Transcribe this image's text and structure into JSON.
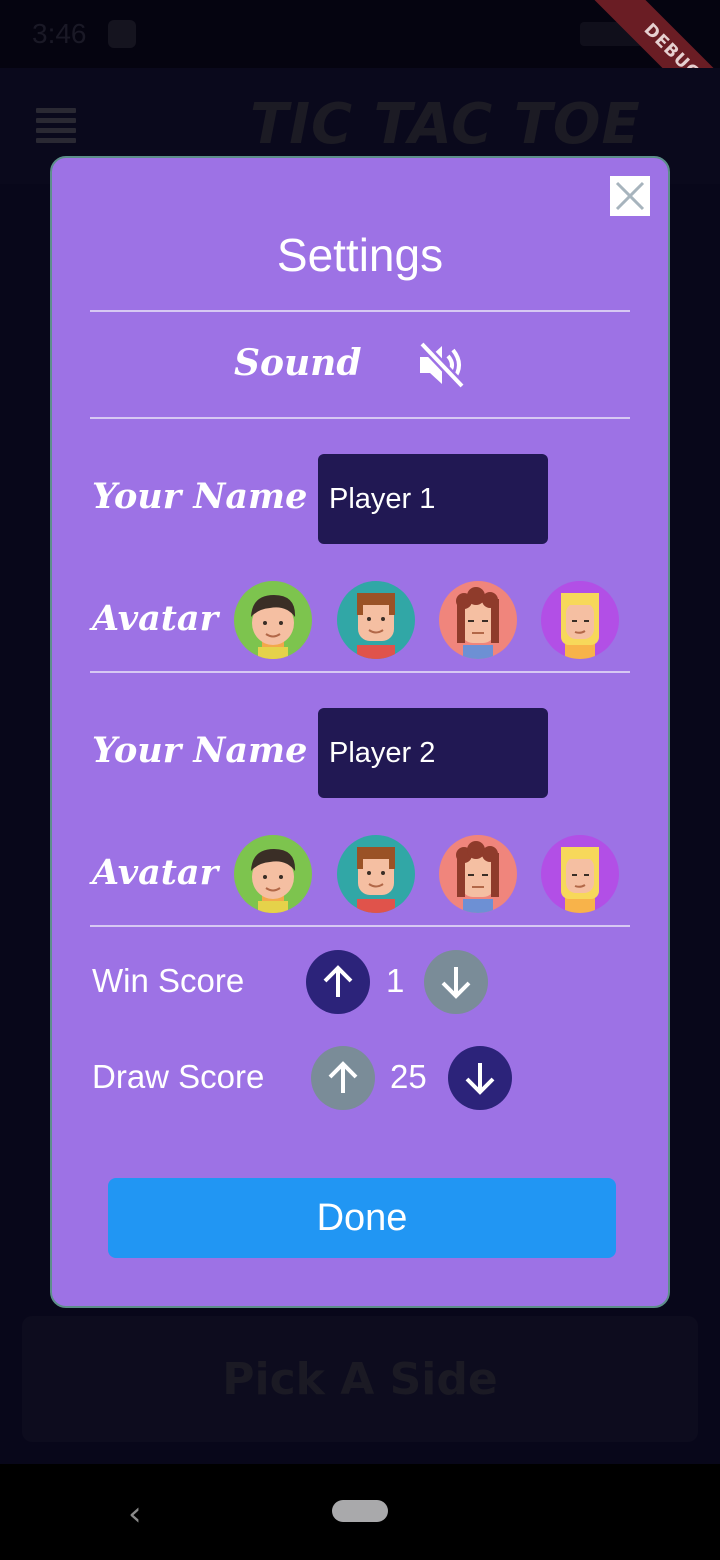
{
  "status_bar": {
    "time": "3:46"
  },
  "debug_badge": "DEBUG",
  "app": {
    "title": "TIC TAC TOE",
    "pick_side_label": "Pick A Side"
  },
  "dialog": {
    "title": "Settings",
    "close_icon": "close-icon",
    "sound": {
      "label": "Sound",
      "icon": "volume-off-icon"
    },
    "players": [
      {
        "name_label": "Your Name",
        "name_value": "Player 1",
        "avatar_label": "Avatar",
        "avatars": [
          "avatar-green-boy",
          "avatar-teal-man",
          "avatar-red-curly",
          "avatar-purple-blonde"
        ]
      },
      {
        "name_label": "Your Name",
        "name_value": "Player 2",
        "avatar_label": "Avatar",
        "avatars": [
          "avatar-green-boy",
          "avatar-teal-man",
          "avatar-red-curly",
          "avatar-purple-blonde"
        ]
      }
    ],
    "win_score": {
      "label": "Win Score",
      "value": "1"
    },
    "draw_score": {
      "label": "Draw Score",
      "value": "25"
    },
    "done_label": "Done"
  },
  "colors": {
    "dialog_bg": "#9d72e5",
    "input_bg": "#211853",
    "button_active": "#2c237a",
    "button_disabled": "#7a8c98",
    "done_button": "#2196f3"
  }
}
